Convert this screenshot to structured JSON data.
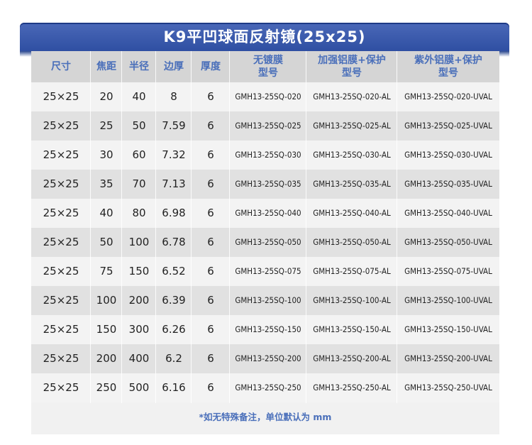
{
  "title": "K9平凹球面反射镜(25x25)",
  "headers": [
    {
      "line1": "尺寸",
      "line2": ""
    },
    {
      "line1": "焦距",
      "line2": ""
    },
    {
      "line1": "半径",
      "line2": ""
    },
    {
      "line1": "边厚",
      "line2": ""
    },
    {
      "line1": "厚度",
      "line2": ""
    },
    {
      "line1": "无镀膜",
      "line2": "型号"
    },
    {
      "line1": "加强铝膜+保护",
      "line2": "型号"
    },
    {
      "line1": "紫外铝膜+保护",
      "line2": "型号"
    }
  ],
  "rows": [
    [
      "25×25",
      "20",
      "40",
      "8",
      "6",
      "GMH13-25SQ-020",
      "GMH13-25SQ-020-AL",
      "GMH13-25SQ-020-UVAL"
    ],
    [
      "25×25",
      "25",
      "50",
      "7.59",
      "6",
      "GMH13-25SQ-025",
      "GMH13-25SQ-025-AL",
      "GMH13-25SQ-025-UVAL"
    ],
    [
      "25×25",
      "30",
      "60",
      "7.32",
      "6",
      "GMH13-25SQ-030",
      "GMH13-25SQ-030-AL",
      "GMH13-25SQ-030-UVAL"
    ],
    [
      "25×25",
      "35",
      "70",
      "7.13",
      "6",
      "GMH13-25SQ-035",
      "GMH13-25SQ-035-AL",
      "GMH13-25SQ-035-UVAL"
    ],
    [
      "25×25",
      "40",
      "80",
      "6.98",
      "6",
      "GMH13-25SQ-040",
      "GMH13-25SQ-040-AL",
      "GMH13-25SQ-040-UVAL"
    ],
    [
      "25×25",
      "50",
      "100",
      "6.78",
      "6",
      "GMH13-25SQ-050",
      "GMH13-25SQ-050-AL",
      "GMH13-25SQ-050-UVAL"
    ],
    [
      "25×25",
      "75",
      "150",
      "6.52",
      "6",
      "GMH13-25SQ-075",
      "GMH13-25SQ-075-AL",
      "GMH13-25SQ-075-UVAL"
    ],
    [
      "25×25",
      "100",
      "200",
      "6.39",
      "6",
      "GMH13-25SQ-100",
      "GMH13-25SQ-100-AL",
      "GMH13-25SQ-100-UVAL"
    ],
    [
      "25×25",
      "150",
      "300",
      "6.26",
      "6",
      "GMH13-25SQ-150",
      "GMH13-25SQ-150-AL",
      "GMH13-25SQ-150-UVAL"
    ],
    [
      "25×25",
      "200",
      "400",
      "6.2",
      "6",
      "GMH13-25SQ-200",
      "GMH13-25SQ-200-AL",
      "GMH13-25SQ-200-UVAL"
    ],
    [
      "25×25",
      "250",
      "500",
      "6.16",
      "6",
      "GMH13-25SQ-250",
      "GMH13-25SQ-250-AL",
      "GMH13-25SQ-250-UVAL"
    ]
  ],
  "footnote": "*如无特殊备注，单位默认为 mm",
  "colors": {
    "banner": "#2f4fa2",
    "header_text": "#4a6fba",
    "header_bg": "#d5d5d5",
    "row_light": "#f3f3f3",
    "row_dark": "#e1e1e1"
  }
}
